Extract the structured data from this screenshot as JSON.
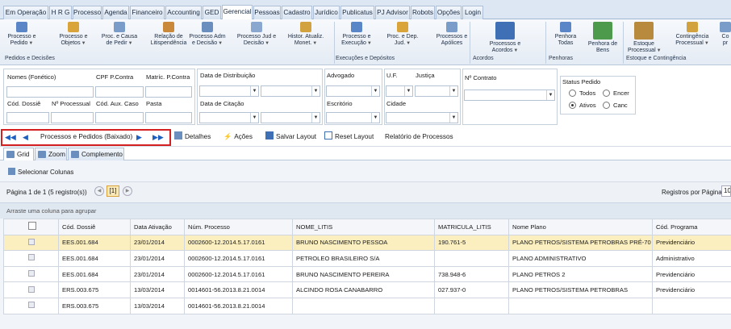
{
  "tabs": [
    "Em Operação",
    "H R G",
    "Processo",
    "Agenda",
    "Financeiro",
    "Accounting",
    "GED",
    "Gerencial",
    "Pessoas",
    "Cadastro",
    "Jurídico",
    "Publicatus",
    "PJ Advisor",
    "Robots",
    "Opções",
    "Login"
  ],
  "active_tab": "Gerencial",
  "ribbon": {
    "buttons": [
      {
        "label": "Processo e\nPedido",
        "arrow": true
      },
      {
        "label": "Processo e\nObjetos",
        "arrow": true
      },
      {
        "label": "Proc. e Causa\nde Pedir",
        "arrow": true
      },
      {
        "label": "Relação de\nLitispendência",
        "arrow": false
      },
      {
        "label": "Processo Adm\ne Decisão",
        "arrow": true
      },
      {
        "label": "Processo Jud e\nDecisão",
        "arrow": true
      },
      {
        "label": "Histor. Atualiz.\nMonet.",
        "arrow": true
      },
      {
        "label": "Processo e\nExecução",
        "arrow": true
      },
      {
        "label": "Proc. e Dep.\nJud.",
        "arrow": true
      },
      {
        "label": "Processos e\nApólices",
        "arrow": false
      },
      {
        "label": "Processos e\nAcordos",
        "arrow": true
      },
      {
        "label": "Penhora\nTodas",
        "arrow": false
      },
      {
        "label": "Penhora de\nBens",
        "arrow": false
      },
      {
        "label": "Estoque\nProcessual",
        "arrow": true
      },
      {
        "label": "Contingência\nProcessual",
        "arrow": true
      },
      {
        "label": "Co\npr",
        "arrow": false
      }
    ],
    "groups": [
      "Pedidos e Decisões",
      "Execuções e Depósitos",
      "Acordos",
      "Penhoras",
      "Estoque e Contingência"
    ]
  },
  "filters": {
    "nomes": "Nomes (Fonético)",
    "cpf": "CPF P.Contra",
    "matric": "Matríc. P.Contra",
    "dossie": "Cód. Dossiê",
    "nproc": "Nº Processual",
    "aux": "Cód. Aux. Caso",
    "pasta": "Pasta",
    "distrib": "Data de Distribuição",
    "citacao": "Data de Citação",
    "advogado": "Advogado",
    "escritorio": "Escritório",
    "uf": "U.F.",
    "justica": "Justiça",
    "cidade": "Cidade",
    "contrato": "Nº Contrato",
    "status_title": "Status Pedido",
    "status_options": [
      "Todos",
      "Encer",
      "Ativos",
      "Canc"
    ],
    "status_selected": "Ativos"
  },
  "toolbar": {
    "nav_label": "Processos e Pedidos (Baixado)",
    "detalhes": "Detalhes",
    "acoes": "Ações",
    "salvar": "Salvar Layout",
    "reset": "Reset Layout",
    "relatorio": "Relatório de Processos"
  },
  "subtabs": [
    "Grid",
    "Zoom",
    "Complemento"
  ],
  "grid": {
    "select_cols": "Selecionar Colunas",
    "page_info": "Página 1 de 1 (5 registro(s))",
    "current_page": "[1]",
    "per_page_label": "Registros por Página",
    "per_page_value": "10",
    "group_hint": "Arraste uma coluna para agrupar",
    "columns": [
      "",
      "Cód. Dossiê",
      "Data Ativação",
      "Núm. Processo",
      "NOME_LITIS",
      "MATRICULA_LITIS",
      "Nome Plano",
      "Cód. Programa"
    ],
    "rows": [
      [
        "EES.001.684",
        "23/01/2014",
        "0002600-12.2014.5.17.0161",
        "BRUNO NASCIMENTO PESSOA",
        "190.761-5",
        "PLANO PETROS/SISTEMA PETROBRAS PRÉ-70",
        "Previdenciário"
      ],
      [
        "EES.001.684",
        "23/01/2014",
        "0002600-12.2014.5.17.0161",
        "PETROLEO BRASILEIRO S/A",
        "",
        "PLANO ADMINISTRATIVO",
        "Administrativo"
      ],
      [
        "EES.001.684",
        "23/01/2014",
        "0002600-12.2014.5.17.0161",
        "BRUNO NASCIMENTO PEREIRA",
        "738.948-6",
        "PLANO PETROS 2",
        "Previdenciário"
      ],
      [
        "ERS.003.675",
        "13/03/2014",
        "0014601-56.2013.8.21.0014",
        "ALCINDO ROSA CANABARRO",
        "027.937-0",
        "PLANO PETROS/SISTEMA PETROBRAS",
        "Previdenciário"
      ],
      [
        "ERS.003.675",
        "13/03/2014",
        "0014601-56.2013.8.21.0014",
        "",
        "",
        "",
        ""
      ]
    ]
  }
}
